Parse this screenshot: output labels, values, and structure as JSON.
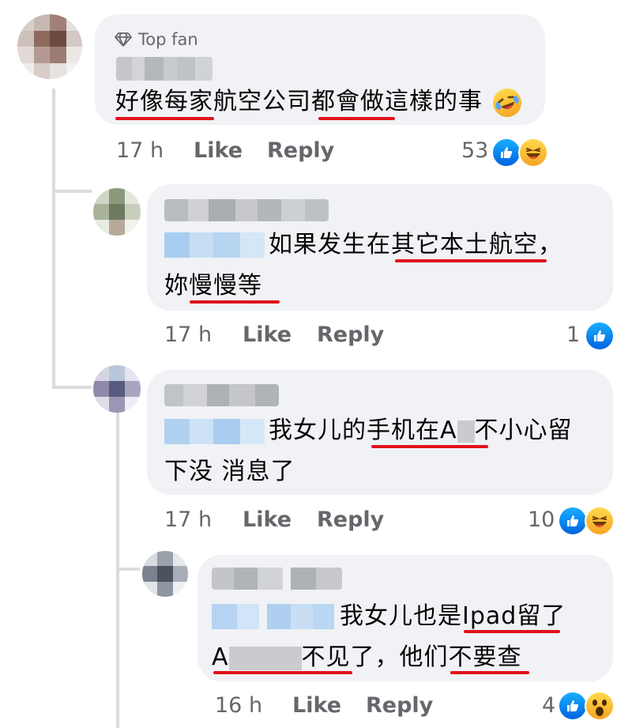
{
  "top_comment": {
    "badge": "Top fan",
    "badge_icon": "diamond-icon",
    "text_parts": [
      "好像每家航空公司",
      "都會做",
      "這樣的事"
    ],
    "emoji": "rolling-laughing-emoji",
    "time": "17 h",
    "like_label": "Like",
    "reply_label": "Reply",
    "reaction_count": "53",
    "reactions": [
      "like",
      "haha"
    ]
  },
  "replies": [
    {
      "line1": "如果发生在其它本土航空，",
      "line2": "妳慢慢等",
      "time": "17 h",
      "like_label": "Like",
      "reply_label": "Reply",
      "reaction_count": "1",
      "reactions": [
        "like"
      ]
    },
    {
      "line1": "我女儿的手机在A",
      "line1_after": "不小心留",
      "line2": "下没 消息了",
      "time": "17 h",
      "like_label": "Like",
      "reply_label": "Reply",
      "reaction_count": "10",
      "reactions": [
        "like",
        "haha"
      ]
    },
    {
      "line1": "我女儿也是Ipad留了",
      "line2_a": "A",
      "line2_b": "不见了，他们不要查",
      "time": "16 h",
      "like_label": "Like",
      "reply_label": "Reply",
      "reaction_count": "4",
      "reactions": [
        "like",
        "wow"
      ]
    }
  ],
  "colors": {
    "bubble": "#f0f2f5",
    "underline": "#e0121b",
    "meta": "#65676b",
    "like_blue": "#0866ff"
  }
}
